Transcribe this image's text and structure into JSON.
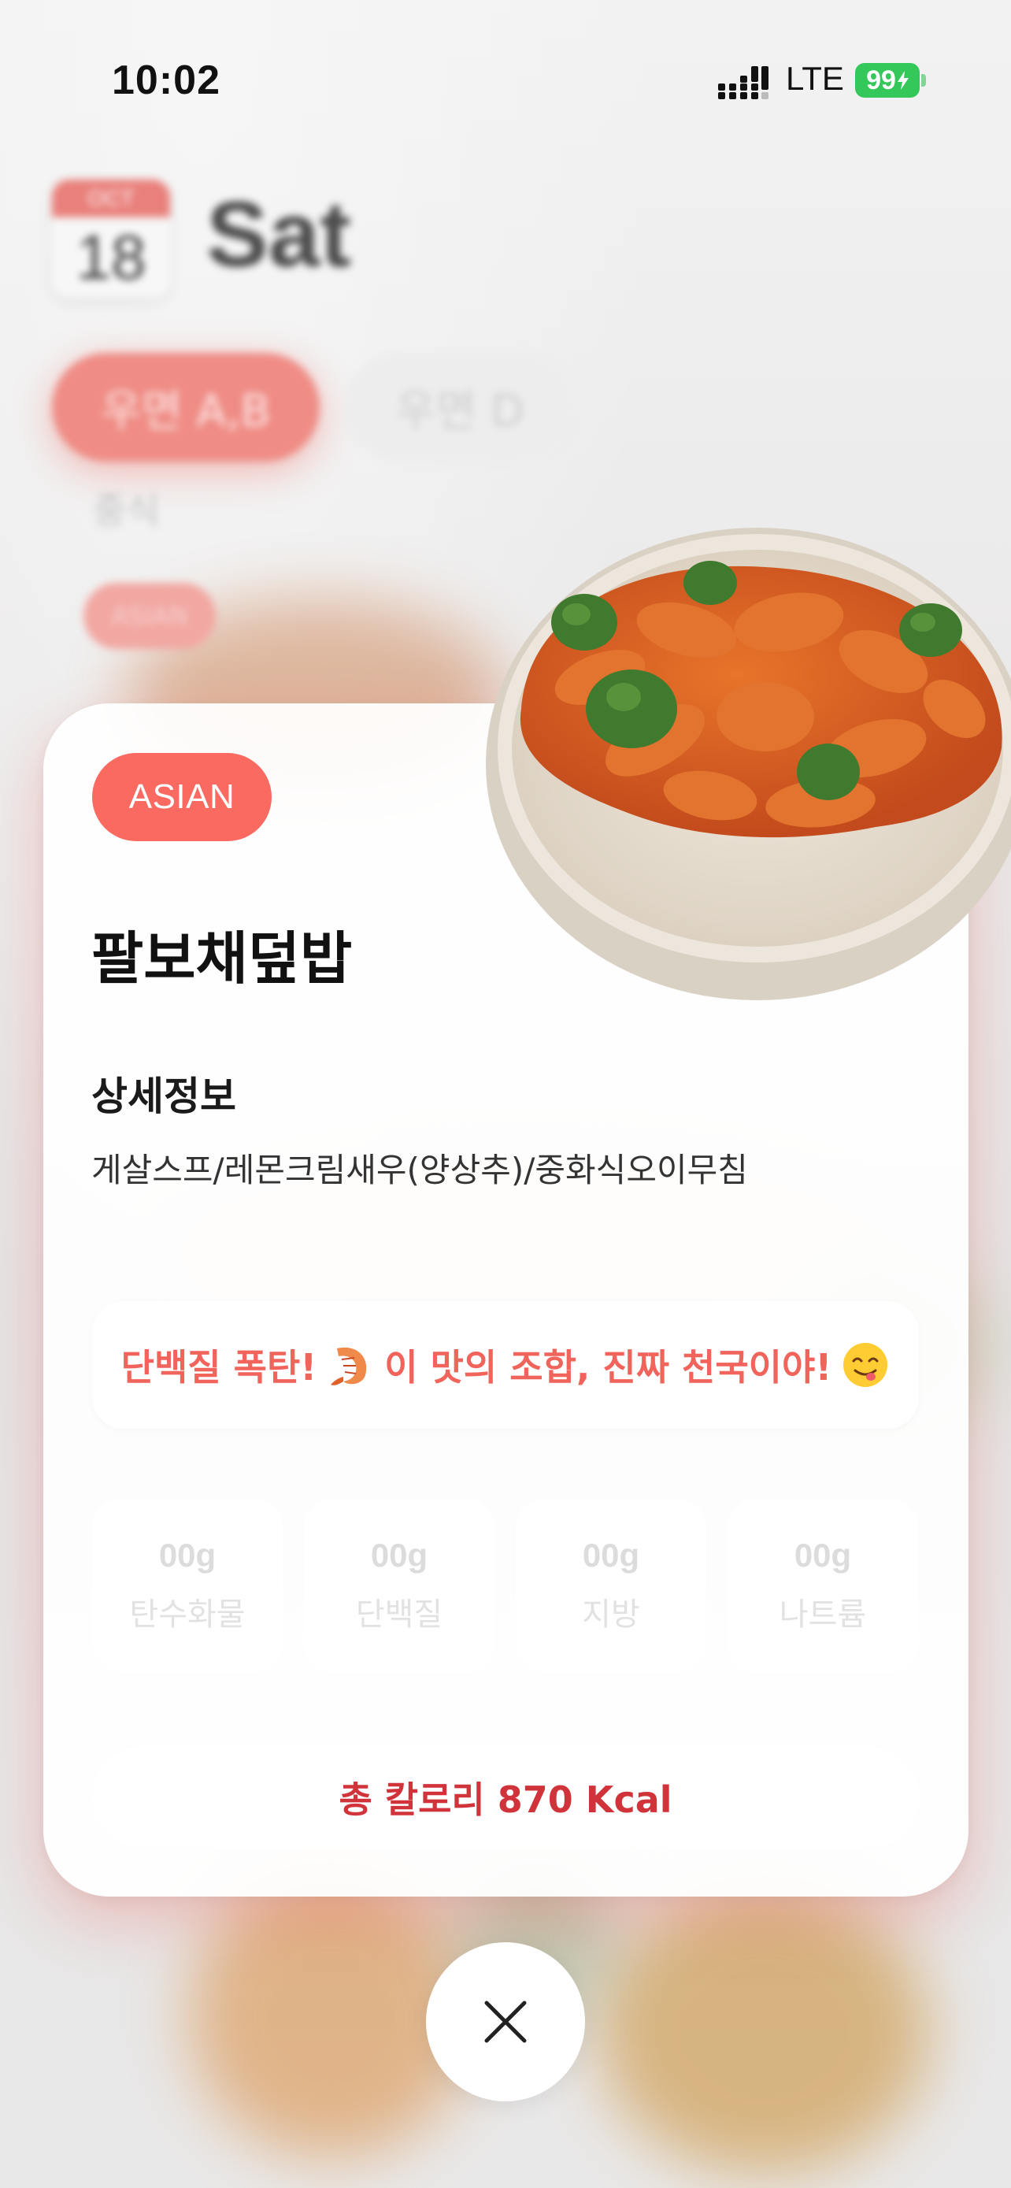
{
  "status_bar": {
    "time": "10:02",
    "network": "LTE",
    "battery": "99"
  },
  "background": {
    "calendar_month": "OCT",
    "calendar_day": "18",
    "day_name": "Sat",
    "menu_tabs": [
      "우면 A,B",
      "우면 D"
    ],
    "category": "중식",
    "tag": "ASIAN"
  },
  "card": {
    "badge": "ASIAN",
    "title": "팔보채덮밥",
    "detail_heading": "상세정보",
    "detail_text": "게살스프/레몬크림새우(양상추)/중화식오이무침",
    "promo": {
      "part1": "단백질 폭탄!",
      "part2": "이 맛의 조합, 진짜 천국이야!",
      "icons": [
        "shrimp-icon",
        "yum-face-icon"
      ]
    },
    "nutrition": [
      {
        "value": "00g",
        "label": "탄수화물"
      },
      {
        "value": "00g",
        "label": "단백질"
      },
      {
        "value": "00g",
        "label": "지방"
      },
      {
        "value": "00g",
        "label": "나트륨"
      }
    ],
    "calories": "총 칼로리 870 Kcal"
  },
  "colors": {
    "accent": "#fb6a61",
    "promo_text": "#f0645b",
    "calorie_text": "#d0343a",
    "battery": "#34c759"
  }
}
